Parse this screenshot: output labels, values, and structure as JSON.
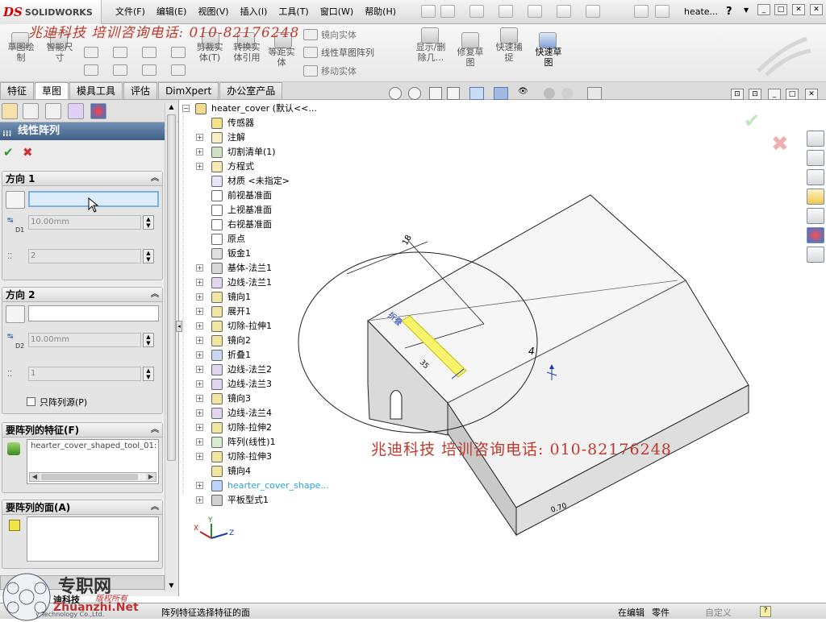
{
  "app": {
    "logo_text": "SOLIDWORKS",
    "menu": [
      "文件(F)",
      "编辑(E)",
      "视图(V)",
      "插入(I)",
      "工具(T)",
      "窗口(W)",
      "帮助(H)"
    ],
    "document_title": "heate...",
    "help_glyph": "?",
    "watermark_top": "兆迪科技  培训咨询电话: 010-82176248"
  },
  "toolbar": {
    "sketch": "草图绘\n制",
    "smart_dim": "智能尺\n寸",
    "trim": "剪裁实\n体(T)",
    "convert": "转换实\n体引用",
    "offset": "等距实\n体",
    "mirror": "镜向实体",
    "linear_pattern": "线性草图阵列",
    "move": "移动实体",
    "display_delete": "显示/删\n除几...",
    "repair": "修复草\n图",
    "quick_snap": "快速捕\n捉",
    "rapid_sketch": "快速草\n图"
  },
  "tabs": [
    "特征",
    "草图",
    "模具工具",
    "评估",
    "DimXpert",
    "办公室产品"
  ],
  "active_tab_index": 1,
  "property_manager": {
    "title": "线性阵列",
    "help": "?",
    "ok_glyph": "✔",
    "cancel_glyph": "✖",
    "direction1": {
      "heading": "方向 1",
      "distance": "10.00mm",
      "count": "2",
      "distance_label": "D1"
    },
    "direction2": {
      "heading": "方向 2",
      "distance": "10.00mm",
      "count": "1",
      "distance_label": "D2",
      "checkbox_label": "只阵列源(P)"
    },
    "features_section": {
      "heading": "要阵列的特征(F)",
      "item": "hearter_cover_shaped_tool_01:"
    },
    "faces_section": {
      "heading": "要阵列的面(A)"
    }
  },
  "tree": {
    "root": "heater_cover  (默认<<...",
    "items": [
      "传感器",
      "注解",
      "切割清单(1)",
      "方程式",
      "材质 <未指定>",
      "前视基准面",
      "上视基准面",
      "右视基准面",
      "原点",
      "钣金1",
      "基体-法兰1",
      "边线-法兰1",
      "镜向1",
      "展开1",
      "切除-拉伸1",
      "镜向2",
      "折叠1",
      "边线-法兰2",
      "边线-法兰3",
      "镜向3",
      "边线-法兰4",
      "切除-拉伸2",
      "阵列(线性)1",
      "切除-拉伸3",
      "镜向4",
      "hearter_cover_shape...",
      "平板型式1"
    ]
  },
  "model_labels": {
    "dim_top": "18",
    "dim_radius": "4",
    "dim_small": "35",
    "dim_bottom": "0.70",
    "feature_tag": "折叠"
  },
  "watermark_bottom": "兆迪科技  培训咨询电话: 010-82176248",
  "status": {
    "left_text": "阵列特征选择特征的面",
    "editing": "在编辑",
    "part": "零件",
    "custom": "自定义",
    "help": "?"
  },
  "corner_logo": {
    "site_cn": "专职网",
    "site_en": "Zhuanzhi.Net",
    "company": "迪科技",
    "slogan": "版权所有",
    "company_en": "y Technology Co.,Ltd."
  },
  "axes": {
    "x": "X",
    "y": "Y",
    "z": "Z"
  },
  "colors": {
    "accent_red": "#c0392b",
    "header_blue": "#4a6a92",
    "check_green": "#2e9a2e",
    "cancel_red": "#d23030"
  }
}
